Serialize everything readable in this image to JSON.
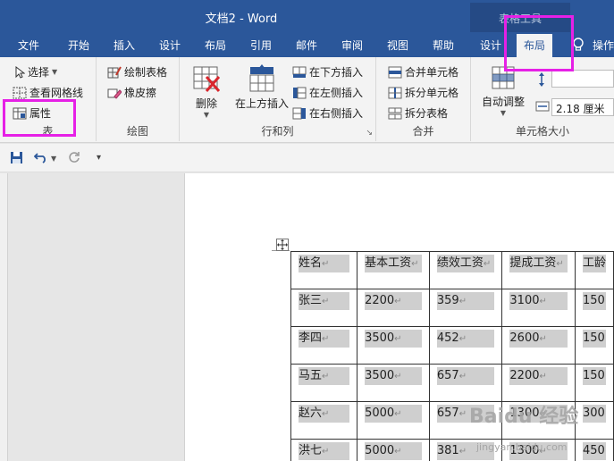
{
  "window": {
    "title": "文档2  -  Word",
    "context_group": "表格工具"
  },
  "tabs": [
    {
      "label": "文件"
    },
    {
      "label": "开始"
    },
    {
      "label": "插入"
    },
    {
      "label": "设计"
    },
    {
      "label": "布局"
    },
    {
      "label": "引用"
    },
    {
      "label": "邮件"
    },
    {
      "label": "审阅"
    },
    {
      "label": "视图"
    },
    {
      "label": "帮助"
    },
    {
      "label": "设计"
    },
    {
      "label": "布局"
    },
    {
      "label": "操作"
    }
  ],
  "ribbon": {
    "table_group": {
      "label": "表",
      "select": "选择",
      "view_gridlines": "查看网格线",
      "properties": "属性"
    },
    "draw_group": {
      "label": "绘图",
      "draw_table": "绘制表格",
      "eraser": "橡皮擦"
    },
    "rows_cols_group": {
      "label": "行和列",
      "delete": "删除",
      "insert_above": "在上方插入",
      "insert_below": "在下方插入",
      "insert_left": "在左侧插入",
      "insert_right": "在右侧插入"
    },
    "merge_group": {
      "label": "合并",
      "merge_cells": "合并单元格",
      "split_cells": "拆分单元格",
      "split_table": "拆分表格"
    },
    "cell_size_group": {
      "label": "单元格大小",
      "autofit": "自动调整",
      "width_value": "2.18 厘米"
    }
  },
  "table": {
    "headers": [
      "姓名",
      "基本工资",
      "绩效工资",
      "提成工资",
      "工龄"
    ],
    "rows": [
      [
        "张三",
        "2200",
        "359",
        "3100",
        "150"
      ],
      [
        "李四",
        "3500",
        "452",
        "2600",
        "150"
      ],
      [
        "马五",
        "3500",
        "657",
        "2200",
        "150"
      ],
      [
        "赵六",
        "5000",
        "657",
        "1300",
        "300"
      ],
      [
        "洪七",
        "5000",
        "381",
        "1300",
        "450"
      ]
    ]
  },
  "watermark": {
    "main": "Baidu 经验",
    "sub": "jingyan.baidu.com"
  },
  "colors": {
    "accent": "#2b579a",
    "highlight": "#e620e6"
  }
}
